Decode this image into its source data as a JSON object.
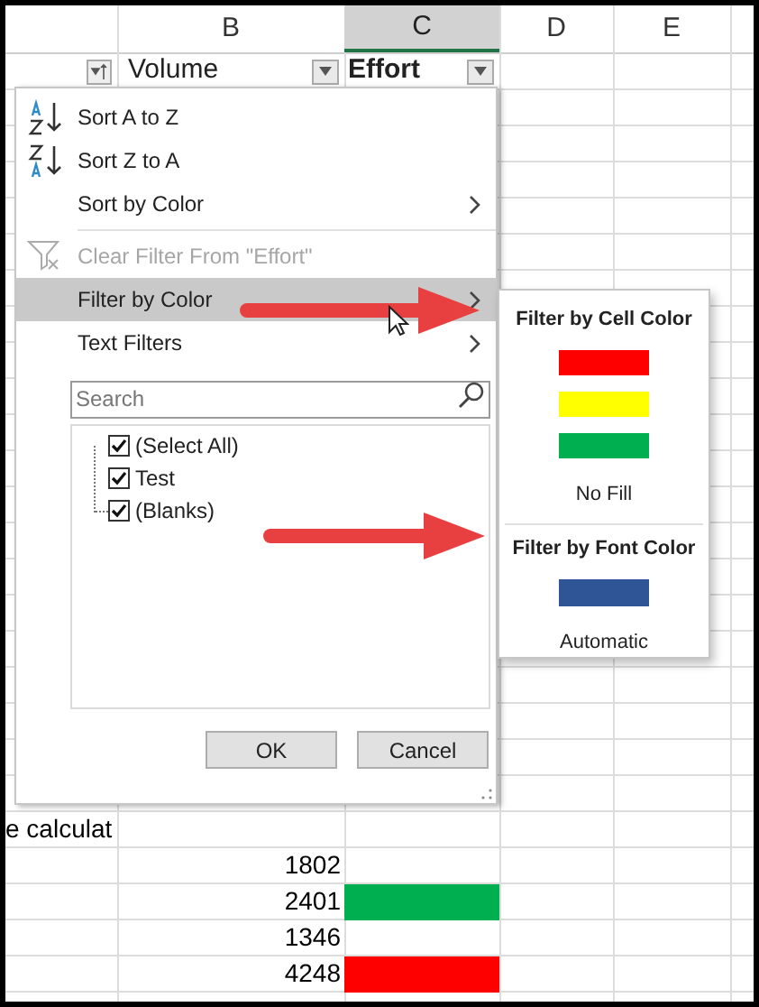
{
  "columns": [
    {
      "label": "B",
      "selected": false
    },
    {
      "label": "C",
      "selected": true
    },
    {
      "label": "D",
      "selected": false
    },
    {
      "label": "E",
      "selected": false
    }
  ],
  "header_row": {
    "volume": "Volume",
    "effort": "Effort"
  },
  "rows": [
    {
      "column_a": "e calculat"
    },
    {
      "volume": "1802"
    },
    {
      "volume": "2401",
      "color": "#00b050"
    },
    {
      "volume": "1346"
    },
    {
      "volume": "4248",
      "color": "#ff0000"
    }
  ],
  "filter_menu": {
    "items": [
      {
        "kind": "sort_ascending",
        "label": "Sort A to Z",
        "selected": false,
        "disabled": false
      },
      {
        "kind": "sort_descending",
        "label": "Sort Z to A",
        "selected": false,
        "disabled": false
      },
      {
        "kind": "submenu",
        "label": "Sort by Color",
        "selected": false,
        "disabled": false
      },
      {
        "kind": "clear_filter",
        "label": "Clear Filter From \"Effort\"",
        "selected": false,
        "disabled": true
      },
      {
        "kind": "submenu",
        "label": "Filter by Color",
        "selected": true,
        "disabled": false
      },
      {
        "kind": "submenu",
        "label": "Text Filters",
        "selected": false,
        "disabled": false
      }
    ],
    "search": {
      "placeholder": "Search"
    },
    "values": [
      {
        "label": "(Select All)",
        "checked": true
      },
      {
        "label": "Test",
        "checked": true
      },
      {
        "label": "(Blanks)",
        "checked": true
      }
    ],
    "buttons": [
      "OK",
      "Cancel"
    ]
  },
  "color_submenu": {
    "cell_color_heading": "Filter by Cell Color",
    "cell_colors": [
      {
        "color": "#ff0000"
      },
      {
        "color": "#ffff00"
      },
      {
        "color": "#00b050"
      }
    ],
    "no_fill": "No Fill",
    "font_color_heading": "Filter by Font Color",
    "font_colors": [
      {
        "color": "#2f5597"
      }
    ],
    "automatic": "Automatic"
  }
}
